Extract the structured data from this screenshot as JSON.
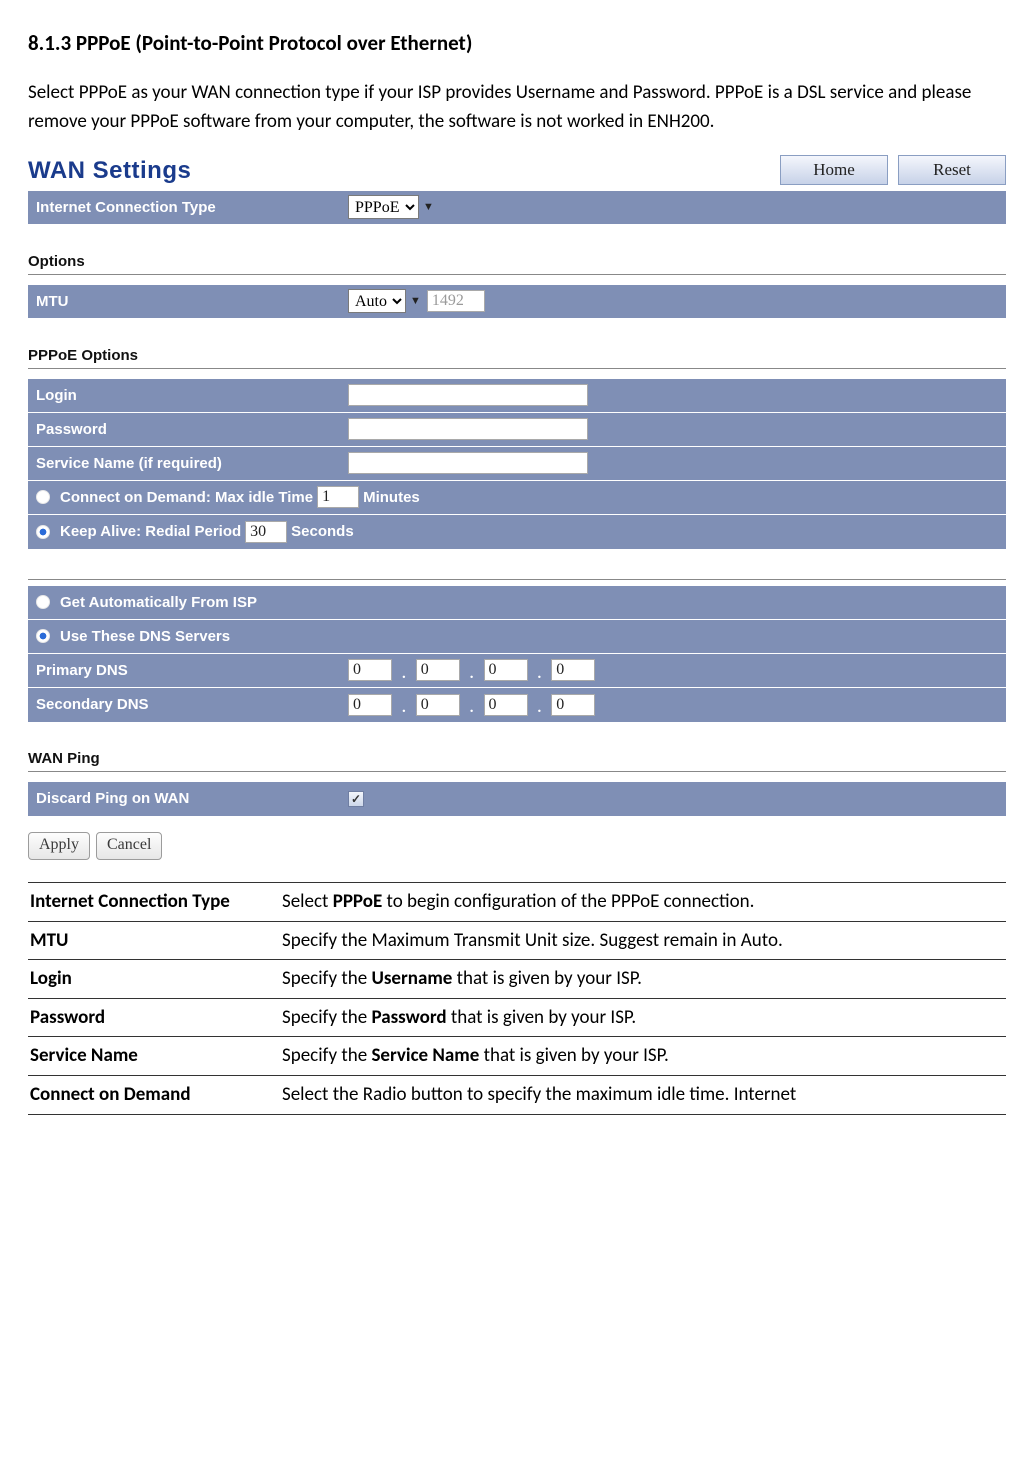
{
  "heading": "8.1.3 PPPoE (Point-to-Point Protocol over Ethernet)",
  "intro": "Select PPPoE as your WAN connection type if your ISP provides Username and Password. PPPoE is a DSL service and please remove your PPPoE software from your computer, the software is not worked in ENH200.",
  "shot": {
    "title": "WAN Settings",
    "btn_home": "Home",
    "btn_reset": "Reset",
    "conn_type_label": "Internet Connection Type",
    "conn_type_value": "PPPoE",
    "options_hdr": "Options",
    "mtu_label": "MTU",
    "mtu_mode": "Auto",
    "mtu_value": "1492",
    "pppoe_hdr": "PPPoE Options",
    "login_label": "Login",
    "login_value": "",
    "password_label": "Password",
    "password_value": "",
    "service_label": "Service Name (if required)",
    "service_value": "",
    "cod_pre": "Connect on Demand: Max idle Time",
    "cod_val": "1",
    "cod_post": "Minutes",
    "ka_pre": "Keep Alive: Redial Period",
    "ka_val": "30",
    "ka_post": "Seconds",
    "dns_auto": "Get Automatically From ISP",
    "dns_manual": "Use These DNS Servers",
    "pdns_label": "Primary DNS",
    "sdns_label": "Secondary DNS",
    "pdns": [
      "0",
      "0",
      "0",
      "0"
    ],
    "sdns": [
      "0",
      "0",
      "0",
      "0"
    ],
    "wanping_hdr": "WAN Ping",
    "discard_label": "Discard Ping on WAN",
    "apply": "Apply",
    "cancel": "Cancel"
  },
  "desc": {
    "r1k": "Internet Connection Type",
    "r1a": "Select ",
    "r1b": "PPPoE",
    "r1c": " to begin configuration of the PPPoE connection.",
    "r2k": "MTU",
    "r2v": "Specify the Maximum Transmit Unit size. Suggest remain in Auto.",
    "r3k": "Login",
    "r3a": "Specify the ",
    "r3b": "Username",
    "r3c": " that is given by your ISP.",
    "r4k": "Password",
    "r4a": "Specify the ",
    "r4b": "Password",
    "r4c": " that is given by your ISP.",
    "r5k": "Service Name",
    "r5a": "Specify the ",
    "r5b": "Service Name",
    "r5c": " that is given by your ISP.",
    "r6k": "Connect on Demand",
    "r6v": "Select the Radio button to specify the maximum idle time. Internet"
  }
}
